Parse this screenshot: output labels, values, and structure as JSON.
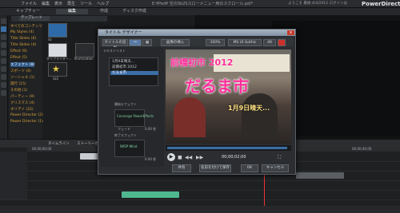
{
  "app": {
    "brand": "PowerDirector",
    "window_title": "E:¥Ped¥ 空のSb2Sスローメニュー用のスクロール.pdl*",
    "user_info": "ようこそ 最後:4/4/2012 ログインは",
    "menu": [
      "ファイル",
      "編集",
      "表示",
      "再生",
      "ツール",
      "ヘルプ"
    ]
  },
  "mode_tabs": [
    "キャプチャー",
    "編集",
    "作成",
    "ディスク作成"
  ],
  "library": {
    "dropdown": "テンプレート",
    "tree": [
      {
        "label": "すべてのコンテンツ",
        "selected": false
      },
      {
        "label": "My Styles (4)",
        "selected": false
      },
      {
        "label": "Title Slides (6)",
        "selected": false
      },
      {
        "label": "Title Slides (4)",
        "selected": false
      },
      {
        "label": "Effect (9)",
        "selected": false
      },
      {
        "label": "Effect (5)",
        "selected": false
      },
      {
        "label": "エフェクト (8)",
        "selected": true
      },
      {
        "label": "スポーツ (4)",
        "selected": false
      },
      {
        "label": "ソーシャル (1)",
        "selected": false
      },
      {
        "label": "旅行 (15)",
        "selected": false
      },
      {
        "label": "その他 (1)",
        "selected": false
      },
      {
        "label": "パーティー (9)",
        "selected": false
      },
      {
        "label": "クリスマス (4)",
        "selected": false
      },
      {
        "label": "ホリデイ (22)",
        "selected": false
      },
      {
        "label": "Power Director (2)",
        "selected": false
      },
      {
        "label": "Power Director (1)",
        "selected": false
      }
    ],
    "thumbs": [
      {
        "caption": "dz",
        "color": "#2f6aa8"
      },
      {
        "caption": "タイプライター...",
        "color": "#d9dde2"
      },
      {
        "caption": "Illumination",
        "color": "#2a2c30"
      },
      {
        "caption": "",
        "color": "#1c1d1f"
      },
      {
        "caption": "dz2",
        "color": "#222325"
      }
    ]
  },
  "dialog": {
    "title": "タイトル デザイナー",
    "close": "x",
    "toolbar": {
      "title_label": "タイトルの追加",
      "image_label": "画像の挿入",
      "zoom": "100%",
      "font": "MS UI Gothic",
      "font_size": "48"
    },
    "text_list_label": "テキストリスト",
    "text_items": [
      {
        "label": "1月9日晴天...",
        "selected": false
      },
      {
        "label": "前橋初市 2012",
        "selected": false
      },
      {
        "label": "だるま市",
        "selected": true
      }
    ],
    "in_effect_label": "開始エフェクト",
    "in_effect_name": "Converge PowerEffects",
    "out_effect_label": "終了エフェクト",
    "out_effect_name": "WISP Wind",
    "fade_label": "フェード",
    "duration1": "0.00 秒",
    "duration2": "0.00 秒",
    "video_text": {
      "line1": "前橋初市 2012",
      "line2": "だるま市",
      "line3": "1月9日晴天..."
    },
    "timecode": "00;00;02;00",
    "foot_buttons": [
      "共有",
      "名前を付けて保存",
      "OK",
      "キャンセル"
    ]
  },
  "timeline": {
    "tabs": [
      "タイムライン",
      "ストーリーボード"
    ],
    "ruler_marks": [
      "00;00;00;00",
      "00;00;10;00",
      "00;00;20;00",
      "00;00;30;00",
      "00;00;40;00"
    ],
    "tracks": 6
  },
  "colors": {
    "accent": "#3c6fa8",
    "title_text": "#ff2e9b",
    "playhead": "#e33333",
    "clip_green": "#4fb88f"
  }
}
